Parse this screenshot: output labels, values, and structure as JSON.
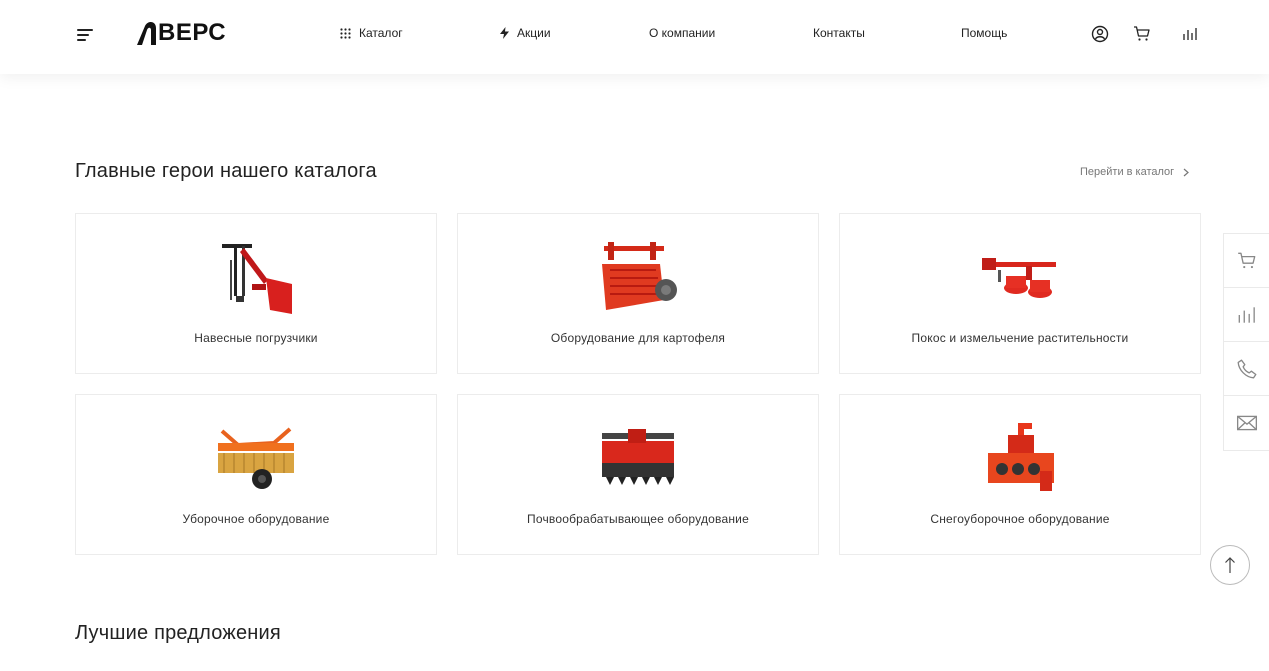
{
  "header": {
    "logo_text": "ВЕРС",
    "nav": [
      {
        "label": "Каталог",
        "icon": "grid-icon"
      },
      {
        "label": "Акции",
        "icon": "lightning-icon"
      },
      {
        "label": "О компании"
      },
      {
        "label": "Контакты"
      },
      {
        "label": "Помощь"
      }
    ],
    "icons": [
      "user-icon",
      "cart-icon",
      "compare-icon"
    ]
  },
  "catalog_section": {
    "title": "Главные герои нашего каталога",
    "link_label": "Перейти в каталог",
    "cards": [
      {
        "label": "Навесные погрузчики"
      },
      {
        "label": "Оборудование для картофеля"
      },
      {
        "label": "Покос и измельчение растительности"
      },
      {
        "label": "Уборочное оборудование"
      },
      {
        "label": "Почвообрабатывающее оборудование"
      },
      {
        "label": "Снегоуборочное оборудование"
      }
    ]
  },
  "side_panel": [
    "cart-icon",
    "compare-icon",
    "phone-icon",
    "mail-icon"
  ],
  "offers_section": {
    "title": "Лучшие предложения"
  },
  "colors": {
    "accent": "#e8361c",
    "text": "#222222",
    "border": "#ececec"
  }
}
